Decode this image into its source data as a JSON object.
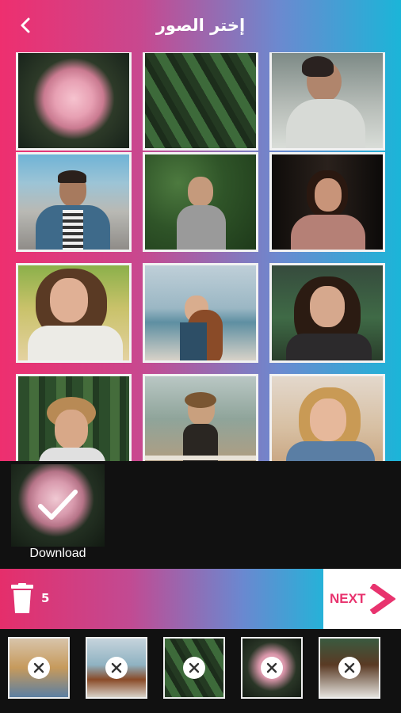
{
  "header": {
    "title": "إختر الصور"
  },
  "grid": {
    "photos": [
      "rose-photo",
      "leaves-photo",
      "man-hoodie-photo",
      "man-building-photo",
      "woman-plants-photo",
      "woman-dark-photo",
      "woman-smiling-photo",
      "woman-beach-photo",
      "woman-field-photo",
      "woman-trees-photo",
      "woman-bridge-photo",
      "woman-denim-photo"
    ]
  },
  "preview": {
    "label": "Download"
  },
  "action_bar": {
    "count": "5",
    "next_label": "NEXT"
  },
  "colors": {
    "accent_pink": "#e8336e",
    "accent_cyan": "#1bb5d8"
  }
}
